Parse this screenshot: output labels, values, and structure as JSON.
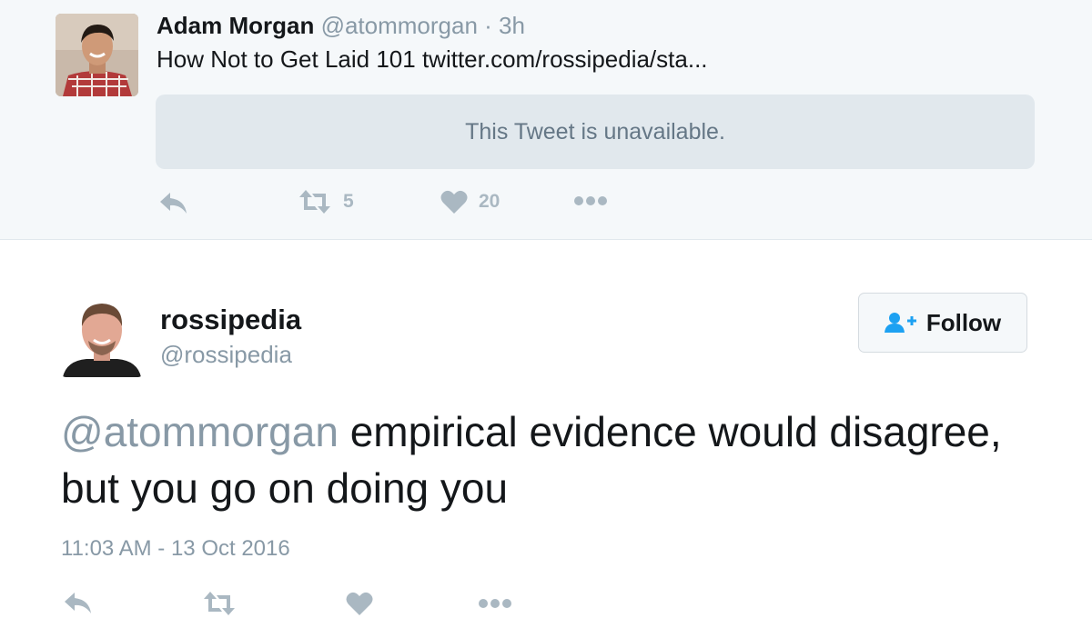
{
  "parent_tweet": {
    "name": "Adam Morgan",
    "handle_time": "@atommorgan · 3h",
    "text": "How Not to Get Laid 101",
    "link": "twitter.com/rossipedia/sta...",
    "quoted_unavailable": "This Tweet is unavailable.",
    "retweet_count": "5",
    "like_count": "20"
  },
  "main_tweet": {
    "name": "rossipedia",
    "handle": "@rossipedia",
    "follow_label": "Follow",
    "mention": "@atommorgan",
    "text": " empirical evidence would disagree, but you go on doing you",
    "timestamp": "11:03 AM - 13 Oct 2016"
  },
  "icons": [
    "reply-icon",
    "retweet-icon",
    "like-icon",
    "more-icon",
    "follow-icon"
  ],
  "colors": {
    "muted": "#8899a6",
    "icon_gray": "#aab8c2",
    "follow_blue": "#1da1f2",
    "parent_bg": "#f5f8fa",
    "unavailable_bg": "#e1e8ed"
  }
}
